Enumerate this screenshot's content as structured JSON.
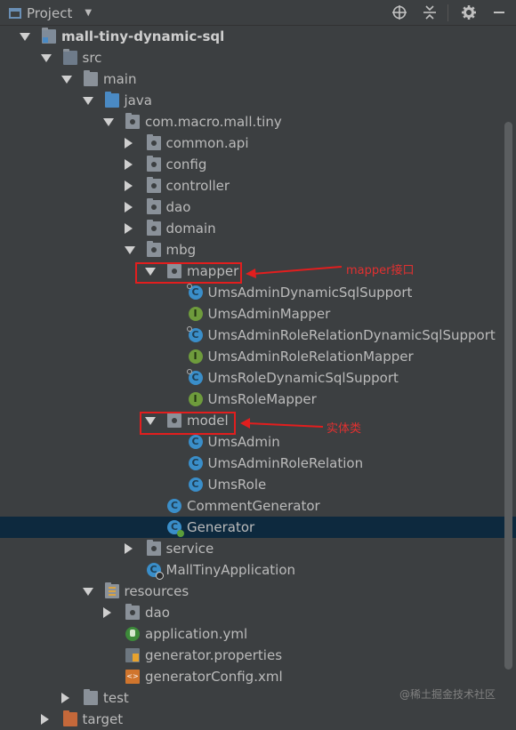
{
  "toolbar": {
    "title": "Project",
    "dropdown_glyph": "▼",
    "icons": [
      "locate-icon",
      "collapse-all-icon",
      "gear-icon",
      "hide-icon"
    ]
  },
  "tree": [
    {
      "id": "r0",
      "label": "mall-tiny-dynamic-sql",
      "depth": 0,
      "expander": "down",
      "icon": "module-folder",
      "bold": true
    },
    {
      "id": "r1",
      "label": "src",
      "depth": 1,
      "expander": "down",
      "icon": "source-folder"
    },
    {
      "id": "r2",
      "label": "main",
      "depth": 2,
      "expander": "down",
      "icon": "folder"
    },
    {
      "id": "r3",
      "label": "java",
      "depth": 3,
      "expander": "down",
      "icon": "java-source-folder"
    },
    {
      "id": "r4",
      "label": "com.macro.mall.tiny",
      "depth": 4,
      "expander": "down",
      "icon": "package"
    },
    {
      "id": "r5",
      "label": "common.api",
      "depth": 5,
      "expander": "right",
      "icon": "package"
    },
    {
      "id": "r6",
      "label": "config",
      "depth": 5,
      "expander": "right",
      "icon": "package"
    },
    {
      "id": "r7",
      "label": "controller",
      "depth": 5,
      "expander": "right",
      "icon": "package"
    },
    {
      "id": "r8",
      "label": "dao",
      "depth": 5,
      "expander": "right",
      "icon": "package"
    },
    {
      "id": "r9",
      "label": "domain",
      "depth": 5,
      "expander": "right",
      "icon": "package"
    },
    {
      "id": "r10",
      "label": "mbg",
      "depth": 5,
      "expander": "down",
      "icon": "package"
    },
    {
      "id": "r11",
      "label": "mapper",
      "depth": 6,
      "expander": "down",
      "icon": "package",
      "highlighted": true
    },
    {
      "id": "r12",
      "label": "UmsAdminDynamicSqlSupport",
      "depth": 7,
      "icon": "class-special"
    },
    {
      "id": "r13",
      "label": "UmsAdminMapper",
      "depth": 7,
      "icon": "interface"
    },
    {
      "id": "r14",
      "label": "UmsAdminRoleRelationDynamicSqlSupport",
      "depth": 7,
      "icon": "class-special"
    },
    {
      "id": "r15",
      "label": "UmsAdminRoleRelationMapper",
      "depth": 7,
      "icon": "interface"
    },
    {
      "id": "r16",
      "label": "UmsRoleDynamicSqlSupport",
      "depth": 7,
      "icon": "class-special"
    },
    {
      "id": "r17",
      "label": "UmsRoleMapper",
      "depth": 7,
      "icon": "interface"
    },
    {
      "id": "r18",
      "label": "model",
      "depth": 6,
      "expander": "down",
      "icon": "package",
      "highlighted": true
    },
    {
      "id": "r19",
      "label": "UmsAdmin",
      "depth": 7,
      "icon": "class"
    },
    {
      "id": "r20",
      "label": "UmsAdminRoleRelation",
      "depth": 7,
      "icon": "class"
    },
    {
      "id": "r21",
      "label": "UmsRole",
      "depth": 7,
      "icon": "class"
    },
    {
      "id": "r22",
      "label": "CommentGenerator",
      "depth": 6,
      "icon": "class"
    },
    {
      "id": "r23",
      "label": "Generator",
      "depth": 6,
      "icon": "class-runnable",
      "selected": true
    },
    {
      "id": "r24",
      "label": "service",
      "depth": 5,
      "expander": "right",
      "icon": "package"
    },
    {
      "id": "r25",
      "label": "MallTinyApplication",
      "depth": 5,
      "icon": "class-boot"
    },
    {
      "id": "r26",
      "label": "resources",
      "depth": 3,
      "expander": "down",
      "icon": "resources-folder"
    },
    {
      "id": "r27",
      "label": "dao",
      "depth": 4,
      "expander": "right",
      "icon": "package"
    },
    {
      "id": "r28",
      "label": "application.yml",
      "depth": 4,
      "icon": "yml-file"
    },
    {
      "id": "r29",
      "label": "generator.properties",
      "depth": 4,
      "icon": "properties-file"
    },
    {
      "id": "r30",
      "label": "generatorConfig.xml",
      "depth": 4,
      "icon": "xml-file"
    },
    {
      "id": "r31",
      "label": "test",
      "depth": 2,
      "expander": "right",
      "icon": "test-folder"
    },
    {
      "id": "r32",
      "label": "target",
      "depth": 1,
      "expander": "right",
      "icon": "target-folder"
    }
  ],
  "annotations": {
    "mapper": "mapper接口",
    "model": "实体类"
  },
  "watermark": "@稀土掘金技术社区",
  "colors": {
    "background": "#3c3f41",
    "selection": "#0d293e",
    "annotation_red": "#e21e1e"
  }
}
